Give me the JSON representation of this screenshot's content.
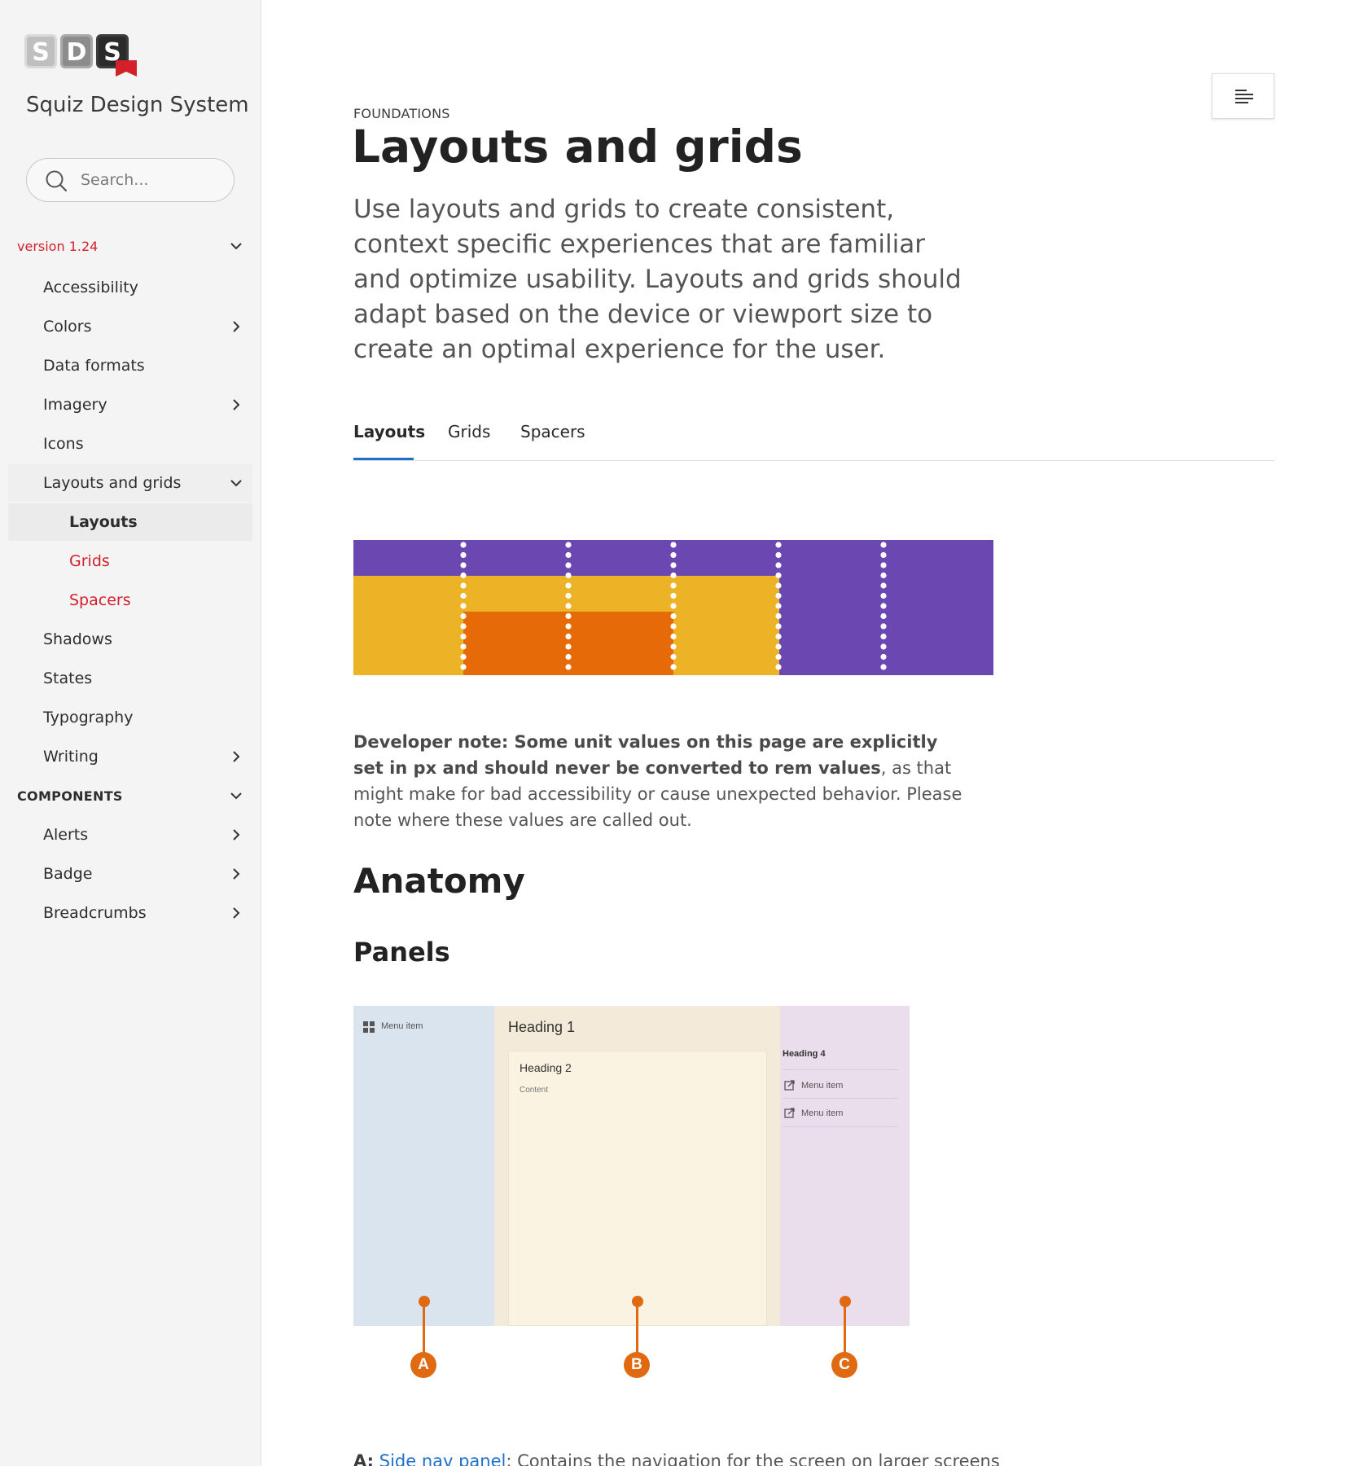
{
  "brand": {
    "name": "Squiz Design System",
    "logo_letters": "SDS"
  },
  "search": {
    "placeholder": "Search..."
  },
  "version": {
    "label": "version 1.24"
  },
  "nav": {
    "accessibility": "Accessibility",
    "colors": "Colors",
    "data_formats": "Data formats",
    "imagery": "Imagery",
    "icons": "Icons",
    "layouts_and_grids": "Layouts and grids",
    "sub_layouts": "Layouts",
    "sub_grids": "Grids",
    "sub_spacers": "Spacers",
    "shadows": "Shadows",
    "states": "States",
    "typography": "Typography",
    "writing": "Writing",
    "components_heading": "COMPONENTS",
    "alerts": "Alerts",
    "badge": "Badge",
    "breadcrumbs": "Breadcrumbs"
  },
  "page": {
    "eyebrow": "FOUNDATIONS",
    "title": "Layouts and grids",
    "lede": "Use layouts and grids to create consistent, context specific experiences that are familiar and optimize usability. Layouts and grids should adapt based on the device or viewport size to create an optimal experience for the user.",
    "tabs": {
      "layouts": "Layouts",
      "grids": "Grids",
      "spacers": "Spacers"
    },
    "devnote_bold": "Developer note: Some unit values on this page are explicitly set in px and should never be converted to rem values",
    "devnote_rest": ", as that might make for bad accessibility or cause unexpected behavior. Please note where these values are called out.",
    "anatomy_heading": "Anatomy",
    "panels_heading": "Panels",
    "bottom_prefix": "A:",
    "bottom_link": "Side nav panel",
    "bottom_rest": ": Contains the navigation for the screen on larger screens"
  },
  "illustration": {
    "left_menu_item": "Menu item",
    "heading1": "Heading 1",
    "heading2": "Heading 2",
    "content": "Content",
    "heading4": "Heading 4",
    "right_menu_item_1": "Menu item",
    "right_menu_item_2": "Menu item",
    "callout_a": "A",
    "callout_b": "B",
    "callout_c": "C"
  },
  "colors": {
    "accent_red": "#d3202a",
    "accent_blue": "#1f6fcc",
    "grid_purple": "#6b47b2",
    "grid_yellow": "#edb327",
    "grid_orange": "#e66a08",
    "callout_orange": "#e06a12"
  }
}
